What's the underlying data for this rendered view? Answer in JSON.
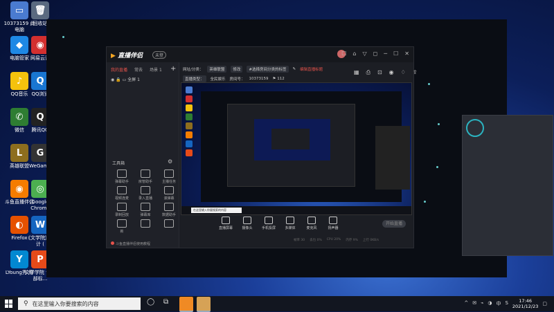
{
  "desktop": {
    "icons": [
      {
        "label": "10373159\n此电脑",
        "glyph": "▭",
        "color": "#4a7bd0"
      },
      {
        "label": "回收站",
        "glyph": "🗑",
        "color": "#5a6a80"
      },
      {
        "label": "电脑管家",
        "glyph": "◆",
        "color": "#1e88e5"
      },
      {
        "label": "网易云音",
        "glyph": "◉",
        "color": "#d32f2f"
      },
      {
        "label": "QQ音乐",
        "glyph": "♪",
        "color": "#f4c20d"
      },
      {
        "label": "QQ浏览",
        "glyph": "Q",
        "color": "#1976d2"
      },
      {
        "label": "微信",
        "glyph": "✆",
        "color": "#2e7d32"
      },
      {
        "label": "腾讯QQ",
        "glyph": "Q",
        "color": "#222"
      },
      {
        "label": "英雄联盟",
        "glyph": "L",
        "color": "#8d6e1e"
      },
      {
        "label": "WeGame",
        "glyph": "G",
        "color": "#333"
      },
      {
        "label": "斗鱼直播伴侣",
        "glyph": "◉",
        "color": "#f57c00"
      },
      {
        "label": "Google Chrome",
        "glyph": "◎",
        "color": "#4caf50"
      },
      {
        "label": "Firefox",
        "glyph": "◐",
        "color": "#e65100"
      },
      {
        "label": "《文学院》设计 (",
        "glyph": "W",
        "color": "#1565c0"
      },
      {
        "label": "LYoung秀 用",
        "glyph": "Y",
        "color": "#0288d1"
      },
      {
        "label": "文学学院 设计部标...",
        "glyph": "P",
        "color": "#e64a19"
      }
    ]
  },
  "app": {
    "logo": "直播伴侣",
    "version": "未登",
    "title_icons": [
      "☐",
      "⌂",
      "▽",
      "◻",
      "─",
      "☐",
      "✕"
    ],
    "tabs": [
      "我的直播",
      "常去",
      "场景 1"
    ],
    "scene": "全屏 1",
    "tools_title": "工具箱",
    "tools": [
      {
        "label": "弹幕助手"
      },
      {
        "label": "房管助手"
      },
      {
        "label": "主播任务"
      },
      {
        "label": "视频连麦"
      },
      {
        "label": "录入直播"
      },
      {
        "label": "滚弹幕"
      },
      {
        "label": "录制回放"
      },
      {
        "label": "弹幕库"
      },
      {
        "label": "数据助手"
      },
      {
        "label": "新"
      },
      {
        "label": ""
      },
      {
        "label": ""
      }
    ],
    "footer": "斗鱼直播伴侣使用教程",
    "info": {
      "row1": [
        "网址/分类：",
        "英雄联盟",
        "修改",
        "#选择房间分类的标签",
        "✎",
        "编辑直播标题"
      ],
      "row2": [
        "直播类型：",
        "全民娱乐",
        "房间号：",
        "10373159",
        "⚑ 112"
      ]
    },
    "right_icons": [
      "▦",
      "⎙",
      "⊡",
      "◉",
      "♢",
      "⇪"
    ],
    "controls": [
      {
        "label": "直播屏幕"
      },
      {
        "label": "摄像头"
      },
      {
        "label": "手机投屏"
      },
      {
        "label": "多媒体"
      },
      {
        "label": "麦克风"
      },
      {
        "label": "扬声器"
      }
    ],
    "start_live": "开始直播",
    "status": [
      "帧率 30",
      "丢包 0%",
      "CPU 20%",
      "内存 9%",
      "上行 0KB/s"
    ],
    "preview_search": "在这里输入你要搜索的内容"
  },
  "taskbar": {
    "search_placeholder": "在这里输入你要搜索的内容",
    "time": "17:46",
    "date": "2021/12/23",
    "tray": [
      "^",
      "✉",
      "⌁",
      "◑",
      "中",
      "S"
    ]
  }
}
